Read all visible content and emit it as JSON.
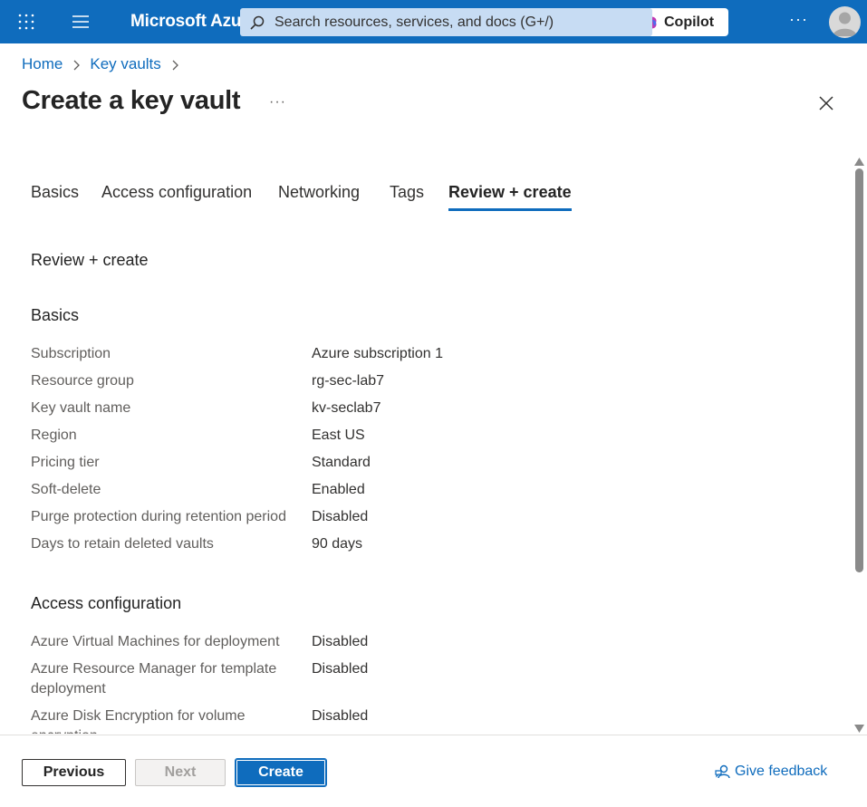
{
  "header": {
    "brand": "Microsoft Azure",
    "search_placeholder": "Search resources, services, and docs (G+/)",
    "copilot_label": "Copilot",
    "more_label": "···"
  },
  "breadcrumb": [
    {
      "label": "Home"
    },
    {
      "label": "Key vaults"
    }
  ],
  "page": {
    "title": "Create a key vault",
    "more_label": "···"
  },
  "tabs": [
    {
      "label": "Basics",
      "active": false
    },
    {
      "label": "Access configuration",
      "active": false
    },
    {
      "label": "Networking",
      "active": false
    },
    {
      "label": "Tags",
      "active": false
    },
    {
      "label": "Review + create",
      "active": true
    }
  ],
  "review": {
    "heading": "Review + create",
    "basics": {
      "heading": "Basics",
      "rows": [
        {
          "label": "Subscription",
          "value": "Azure subscription 1"
        },
        {
          "label": "Resource group",
          "value": "rg-sec-lab7"
        },
        {
          "label": "Key vault name",
          "value": "kv-seclab7"
        },
        {
          "label": "Region",
          "value": "East US"
        },
        {
          "label": "Pricing tier",
          "value": "Standard"
        },
        {
          "label": "Soft-delete",
          "value": "Enabled"
        },
        {
          "label": "Purge protection during retention period",
          "value": "Disabled"
        },
        {
          "label": "Days to retain deleted vaults",
          "value": "90 days"
        }
      ]
    },
    "access": {
      "heading": "Access configuration",
      "rows": [
        {
          "label": "Azure Virtual Machines for deployment",
          "value": "Disabled"
        },
        {
          "label": "Azure Resource Manager for template deployment",
          "value": "Disabled"
        },
        {
          "label": "Azure Disk Encryption for volume encryption",
          "value": "Disabled"
        }
      ]
    }
  },
  "footer": {
    "previous_label": "Previous",
    "next_label": "Next",
    "create_label": "Create",
    "feedback_label": "Give feedback"
  },
  "colors": {
    "accent": "#0f6cbd",
    "topbar": "#0f6cbd",
    "search_bg": "#c7dcf3"
  }
}
